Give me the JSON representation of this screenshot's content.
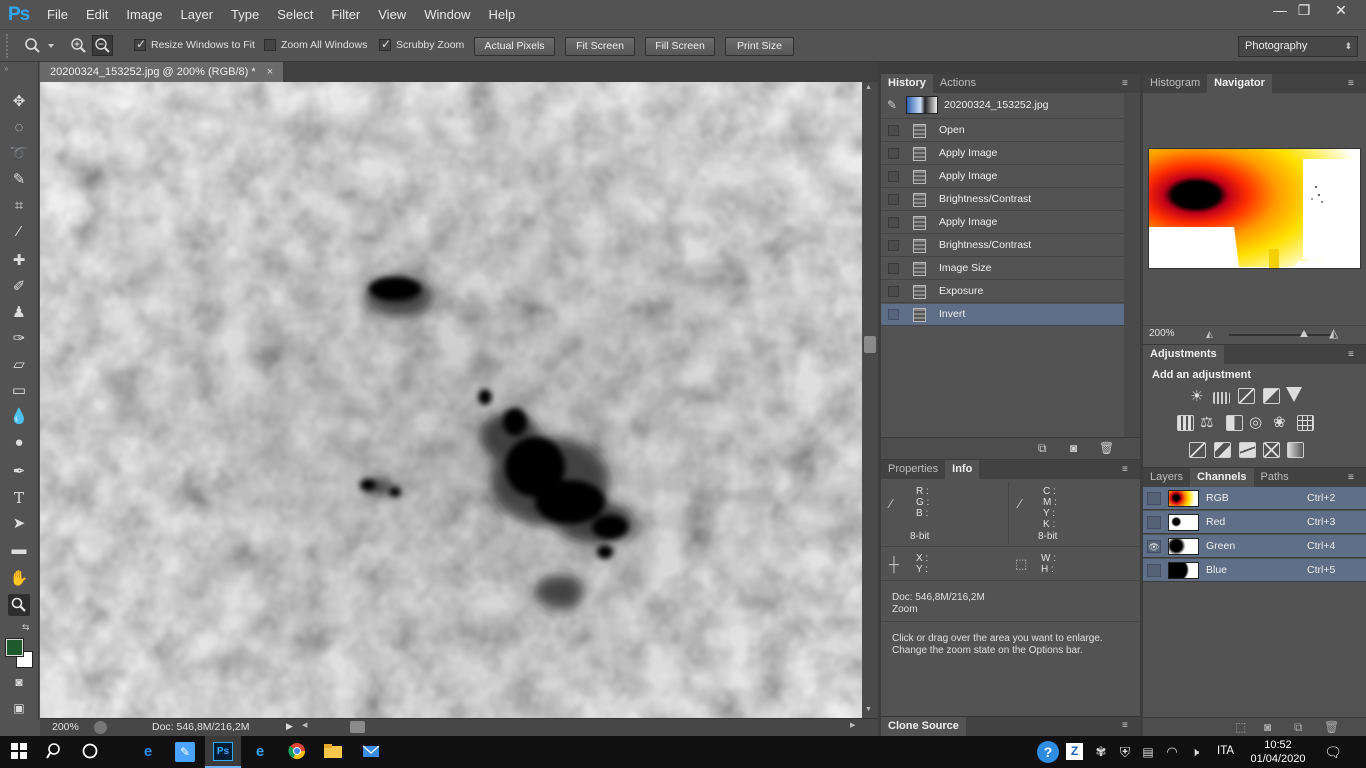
{
  "app": {
    "logo": "Ps"
  },
  "menu": [
    "File",
    "Edit",
    "Image",
    "Layer",
    "Type",
    "Select",
    "Filter",
    "View",
    "Window",
    "Help"
  ],
  "window_controls": {
    "minimize": "—",
    "restore": "❐",
    "close": "✕"
  },
  "options": {
    "resize_windows": "Resize Windows to Fit",
    "zoom_all": "Zoom All Windows",
    "scrubby_zoom": "Scrubby Zoom",
    "buttons": [
      "Actual Pixels",
      "Fit Screen",
      "Fill Screen",
      "Print Size"
    ],
    "workspace": "Photography"
  },
  "document": {
    "tab_title": "20200324_153252.jpg @ 200% (RGB/8) *",
    "close": "×",
    "zoom": "200%",
    "doc_info": "Doc: 546,8M/216,2M"
  },
  "history_panel": {
    "tabs": [
      "History",
      "Actions"
    ],
    "snapshot": "20200324_153252.jpg",
    "steps": [
      "Open",
      "Apply Image",
      "Apply Image",
      "Brightness/Contrast",
      "Apply Image",
      "Brightness/Contrast",
      "Image Size",
      "Exposure",
      "Invert"
    ],
    "selected_step": "Invert"
  },
  "info_panel": {
    "tabs": [
      "Properties",
      "Info"
    ],
    "rgb_labels": [
      "R :",
      "G :",
      "B :"
    ],
    "cmyk_labels": [
      "C :",
      "M :",
      "Y :",
      "K :"
    ],
    "bitdepth_left": "8-bit",
    "bitdepth_right": "8-bit",
    "xy_labels": [
      "X :",
      "Y :"
    ],
    "wh_labels": [
      "W :",
      "H :"
    ],
    "doc": "Doc: 546,8M/216,2M",
    "tool": "Zoom",
    "hint_line1": "Click or drag over the area you want to enlarge.",
    "hint_line2": "Change the zoom state on the Options bar."
  },
  "clone_source": "Clone Source",
  "navigator_panel": {
    "tabs": [
      "Histogram",
      "Navigator"
    ],
    "zoom": "200%",
    "zoom_slider": 0.72
  },
  "adjustments_panel": {
    "title": "Adjustments",
    "subtitle": "Add an adjustment"
  },
  "channels_panel": {
    "tabs": [
      "Layers",
      "Channels",
      "Paths"
    ],
    "channels": [
      {
        "name": "RGB",
        "shortcut": "Ctrl+2"
      },
      {
        "name": "Red",
        "shortcut": "Ctrl+3"
      },
      {
        "name": "Green",
        "shortcut": "Ctrl+4"
      },
      {
        "name": "Blue",
        "shortcut": "Ctrl+5"
      }
    ]
  },
  "taskbar": {
    "language": "ITA",
    "time": "10:52",
    "date": "01/04/2020"
  },
  "colors": {
    "foreground": "#1f5a2c",
    "background": "#ffffff",
    "selection": "#5e6f87",
    "accent": "#31a8ff"
  }
}
